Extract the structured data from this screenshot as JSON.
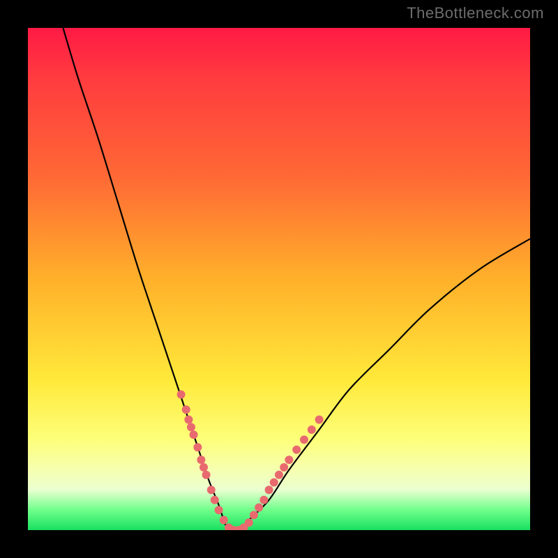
{
  "watermark": "TheBottleneck.com",
  "colors": {
    "curve_stroke": "#000000",
    "dot_fill": "#e86a6f",
    "gradient_top": "#ff1a45",
    "gradient_bottom": "#18e060",
    "background": "#000000"
  },
  "chart_data": {
    "type": "line",
    "title": "",
    "xlabel": "",
    "ylabel": "",
    "xlim": [
      0,
      100
    ],
    "ylim": [
      0,
      100
    ],
    "legend": false,
    "grid": false,
    "series": [
      {
        "name": "bottleneck-curve",
        "x": [
          7,
          10,
          14,
          18,
          22,
          26,
          30,
          32,
          34,
          36,
          38,
          39,
          40,
          42,
          44,
          48,
          52,
          58,
          64,
          72,
          80,
          90,
          100
        ],
        "y": [
          100,
          90,
          78,
          65,
          52,
          40,
          28,
          22,
          16,
          10,
          5,
          2,
          0,
          0,
          2,
          6,
          12,
          20,
          28,
          36,
          44,
          52,
          58
        ]
      }
    ],
    "markers": [
      {
        "x": 30.5,
        "y": 27
      },
      {
        "x": 31.5,
        "y": 24
      },
      {
        "x": 32.0,
        "y": 22
      },
      {
        "x": 32.5,
        "y": 20.5
      },
      {
        "x": 33.0,
        "y": 19
      },
      {
        "x": 33.8,
        "y": 16.5
      },
      {
        "x": 34.5,
        "y": 14
      },
      {
        "x": 35.0,
        "y": 12.5
      },
      {
        "x": 35.5,
        "y": 11
      },
      {
        "x": 36.5,
        "y": 8
      },
      {
        "x": 37.2,
        "y": 6
      },
      {
        "x": 38.0,
        "y": 4
      },
      {
        "x": 39.0,
        "y": 2
      },
      {
        "x": 40.0,
        "y": 0.5
      },
      {
        "x": 41.0,
        "y": 0
      },
      {
        "x": 42.0,
        "y": 0
      },
      {
        "x": 43.0,
        "y": 0.5
      },
      {
        "x": 44.0,
        "y": 1.5
      },
      {
        "x": 45.0,
        "y": 3
      },
      {
        "x": 46.0,
        "y": 4.5
      },
      {
        "x": 47.0,
        "y": 6
      },
      {
        "x": 48.0,
        "y": 8
      },
      {
        "x": 49.0,
        "y": 9.5
      },
      {
        "x": 50.0,
        "y": 11
      },
      {
        "x": 51.0,
        "y": 12.5
      },
      {
        "x": 52.0,
        "y": 14
      },
      {
        "x": 53.5,
        "y": 16
      },
      {
        "x": 55.0,
        "y": 18
      },
      {
        "x": 56.5,
        "y": 20
      },
      {
        "x": 58.0,
        "y": 22
      }
    ]
  }
}
